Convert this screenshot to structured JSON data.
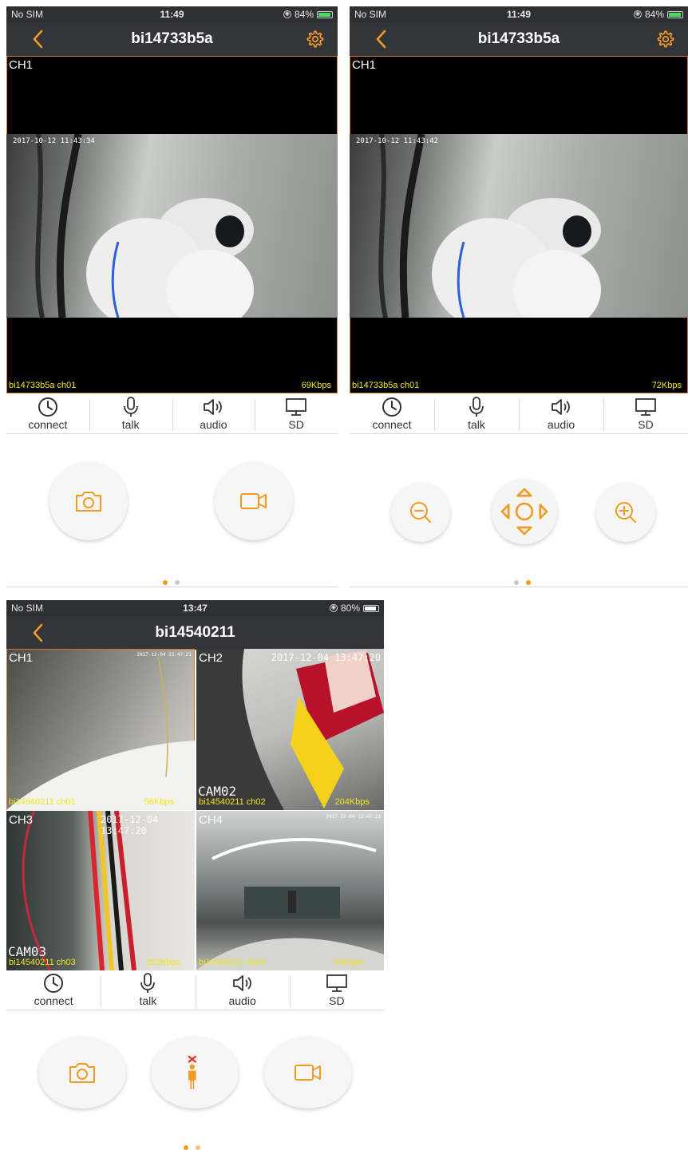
{
  "colors": {
    "accent": "#f39a23",
    "caption_yellow": "#f3e620",
    "selected_border": "#d4732d",
    "navbar_bg": "#343538",
    "dot_inactive": "#c8c8c8",
    "battery_green": "#4cd964"
  },
  "screen1": {
    "status": {
      "carrier": "No SIM",
      "time": "11:49",
      "battery": "84%"
    },
    "title": "bi14733b5a",
    "video": {
      "channel": "CH1",
      "timestamp": "2017-10-12 11:43:34",
      "caption": "bi14733b5a ch01",
      "bitrate": "69Kbps"
    },
    "toolbar": [
      {
        "icon": "clock-icon",
        "label": "connect"
      },
      {
        "icon": "microphone-icon",
        "label": "talk"
      },
      {
        "icon": "speaker-icon",
        "label": "audio"
      },
      {
        "icon": "monitor-icon",
        "label": "SD"
      }
    ],
    "controls": [
      {
        "icon": "camera-icon"
      },
      {
        "icon": "video-record-icon"
      }
    ],
    "page_index": 0,
    "page_count": 2
  },
  "screen2": {
    "status": {
      "carrier": "No SIM",
      "time": "11:49",
      "battery": "84%"
    },
    "title": "bi14733b5a",
    "video": {
      "channel": "CH1",
      "timestamp": "2017-10-12 11:43:42",
      "caption": "bi14733b5a ch01",
      "bitrate": "72Kbps"
    },
    "toolbar": [
      {
        "icon": "clock-icon",
        "label": "connect"
      },
      {
        "icon": "microphone-icon",
        "label": "talk"
      },
      {
        "icon": "speaker-icon",
        "label": "audio"
      },
      {
        "icon": "monitor-icon",
        "label": "SD"
      }
    ],
    "controls": [
      {
        "icon": "zoom-out-icon"
      },
      {
        "icon": "ptz-direction-icon"
      },
      {
        "icon": "zoom-in-icon"
      }
    ],
    "page_index": 1,
    "page_count": 2
  },
  "screen3": {
    "status": {
      "carrier": "No SIM",
      "time": "13:47",
      "battery": "80%"
    },
    "title": "bi14540211",
    "channels": [
      {
        "channel": "CH1",
        "timestamp": "2017-12-04 13:47:21",
        "caption": "bi14540211 ch01",
        "bitrate": "56Kbps",
        "overlay": ""
      },
      {
        "channel": "CH2",
        "timestamp": "2017-12-04 13:47:20",
        "caption": "bi14540211 ch02",
        "bitrate": "204Kbps",
        "overlay": "CAM02"
      },
      {
        "channel": "CH3",
        "timestamp": "2017-12-04 13:47:20",
        "caption": "bi14540211 ch03",
        "bitrate": "202Kbps",
        "overlay": "CAM03"
      },
      {
        "channel": "CH4",
        "timestamp": "2017-12-04 13:47:21",
        "caption": "bi14540211 ch04",
        "bitrate": "33Kbps",
        "overlay": ""
      }
    ],
    "toolbar": [
      {
        "icon": "clock-icon",
        "label": "connect"
      },
      {
        "icon": "microphone-icon",
        "label": "talk"
      },
      {
        "icon": "speaker-icon",
        "label": "audio"
      },
      {
        "icon": "monitor-icon",
        "label": "SD"
      }
    ],
    "controls": [
      {
        "icon": "camera-icon"
      },
      {
        "icon": "person-alarm-off-icon"
      },
      {
        "icon": "video-record-icon"
      }
    ],
    "page_index": 0,
    "page_count": 2
  }
}
